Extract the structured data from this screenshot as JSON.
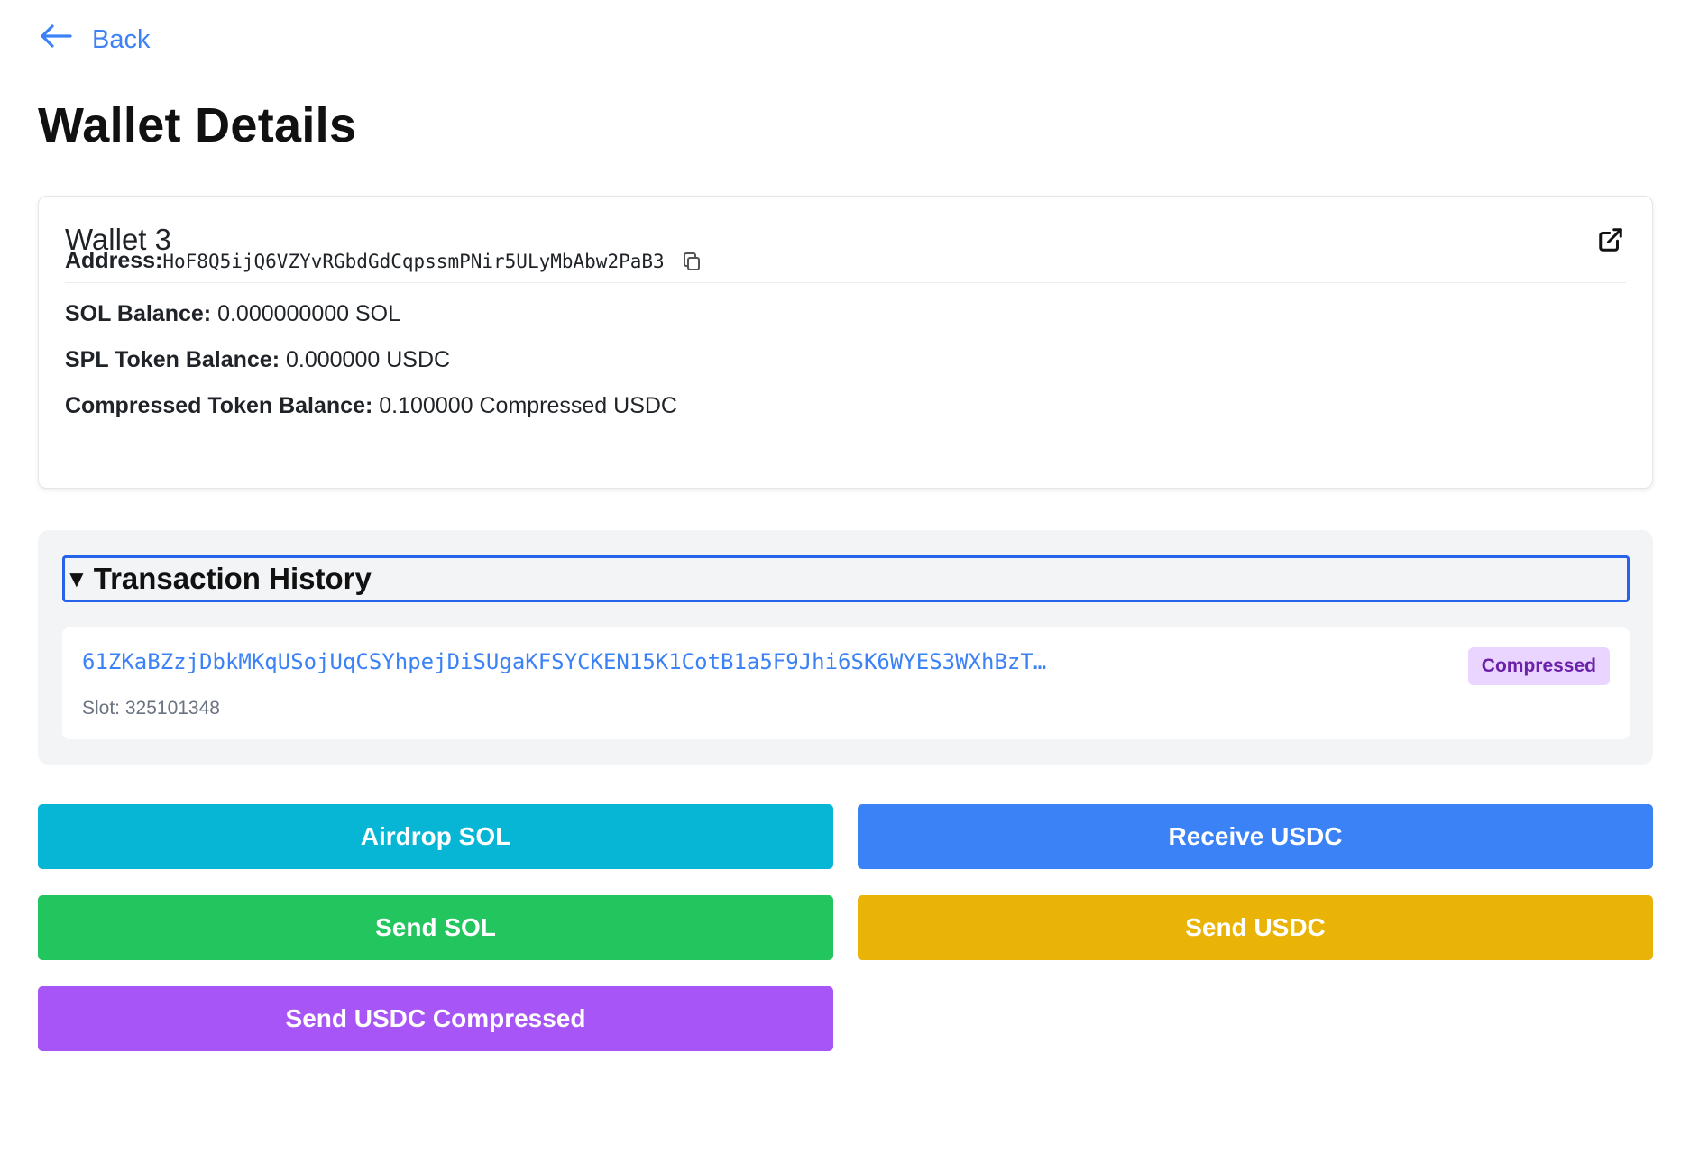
{
  "nav": {
    "back_label": "Back"
  },
  "page": {
    "title": "Wallet Details"
  },
  "wallet": {
    "name": "Wallet 3",
    "address_label": "Address:",
    "address": "HoF8Q5ijQ6VZYvRGbdGdCqpssmPNir5ULyMbAbw2PaB3",
    "sol_label": "SOL Balance:",
    "sol_value": "0.000000000 SOL",
    "spl_label": "SPL Token Balance:",
    "spl_value": "0.000000 USDC",
    "compressed_label": "Compressed Token Balance:",
    "compressed_value": "0.100000 Compressed USDC"
  },
  "history": {
    "title": "Transaction History",
    "items": [
      {
        "signature": "61ZKaBZzjDbkMKqUSojUqCSYhpejDiSUgaKFSYCKEN15K1CotB1a5F9Jhi6SK6WYES3WXhBzT…",
        "slot": "Slot: 325101348",
        "badge": "Compressed"
      }
    ]
  },
  "actions": {
    "airdrop_sol": "Airdrop SOL",
    "receive_usdc": "Receive USDC",
    "send_sol": "Send SOL",
    "send_usdc": "Send USDC",
    "send_usdc_compressed": "Send USDC Compressed"
  },
  "colors": {
    "accent": "#3b82f6",
    "airdrop": "#06b6d4",
    "receive": "#3b82f6",
    "send_sol": "#22c55e",
    "send_usdc": "#eab308",
    "send_compressed": "#a855f7",
    "badge_bg": "#e9d5ff",
    "badge_text": "#6b21a8"
  }
}
